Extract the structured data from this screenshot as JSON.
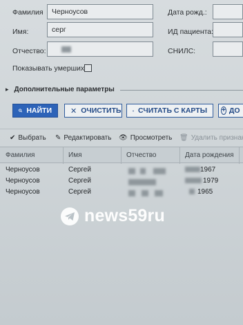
{
  "form": {
    "surname_label": "Фамилия",
    "surname_value": "Черноусов",
    "name_label": "Имя:",
    "name_value": "серг",
    "patronymic_label": "Отчество:",
    "show_deceased_label": "Показывать умерших:",
    "birthdate_label": "Дата рожд.:",
    "patient_id_label": "ИД пациента:",
    "snils_label": "СНИЛС:"
  },
  "extra_params": {
    "label": "Дополнительные параметры"
  },
  "buttons": {
    "find": "НАЙТИ",
    "clear": "ОЧИСТИТЬ",
    "read_card": "СЧИТАТЬ С КАРТЫ",
    "add": "ДО"
  },
  "toolbar": {
    "select": "Выбрать",
    "edit": "Редактировать",
    "view": "Просмотреть",
    "remove_flag": "Удалить признак с"
  },
  "table": {
    "columns": [
      "Фамилия",
      "Имя",
      "Отчество",
      "Дата рождения"
    ],
    "rows": [
      {
        "surname": "Черноусов",
        "name": "Сергей",
        "birth_year": "1967"
      },
      {
        "surname": "Черноусов",
        "name": "Сергей",
        "birth_year": "1979"
      },
      {
        "surname": "Черноусов",
        "name": "Сергей",
        "birth_year": "1965"
      }
    ]
  },
  "watermark": {
    "text": "news59ru",
    "icon": "telegram-icon"
  }
}
